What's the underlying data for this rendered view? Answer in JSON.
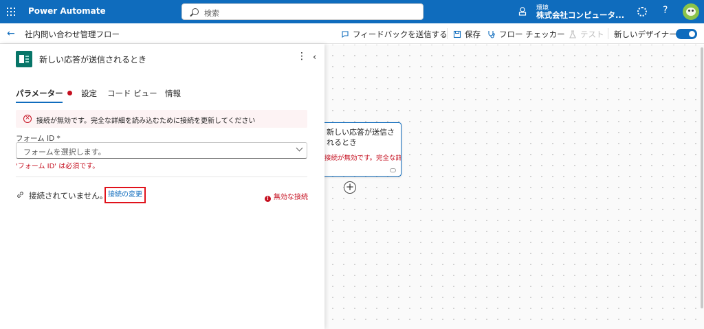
{
  "app": {
    "name": "Power Automate"
  },
  "search": {
    "placeholder": "検索"
  },
  "environment": {
    "label": "環境",
    "name": "株式会社コンピュータ..."
  },
  "header_icons": {
    "settings": "gear-icon",
    "help": "?",
    "avatar": "user-avatar"
  },
  "command_bar": {
    "back": "←",
    "flow_name": "社内問い合わせ管理フロー",
    "feedback": "フィードバックを送信する",
    "save": "保存",
    "flow_checker": "フロー チェッカー",
    "test": "テスト",
    "new_designer": "新しいデザイナー",
    "new_designer_on": true
  },
  "panel": {
    "title": "新しい応答が送信されるとき",
    "menu": "⋮",
    "collapse": "‹",
    "tabs": [
      {
        "label": "パラメーター",
        "active": true,
        "error": true
      },
      {
        "label": "設定"
      },
      {
        "label": "コード ビュー"
      },
      {
        "label": "情報"
      }
    ],
    "error_message": "接続が無効です。完全な詳細を読み込むために接続を更新してください",
    "form_id": {
      "label": "フォーム ID *",
      "placeholder": "フォームを選択します。",
      "error": "'フォーム ID' は必須です。"
    },
    "connection": {
      "status": "接続されていません。",
      "change_link": "接続の変更",
      "invalid": "無効な接続"
    }
  },
  "canvas": {
    "node": {
      "title": "新しい応答が送信されるとき",
      "error": "接続が無効です。完全な詳..."
    },
    "add_step": "+"
  },
  "colors": {
    "brand": "#0f6cbd",
    "error": "#c50f1f",
    "highlight_box": "#e0121b",
    "forms_icon": "#077568"
  }
}
